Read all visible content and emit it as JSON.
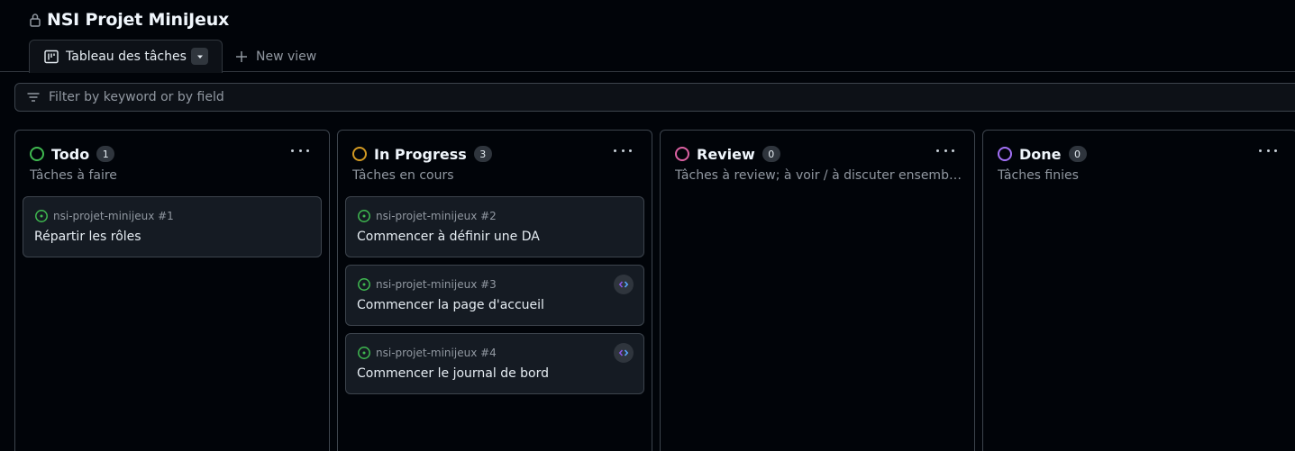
{
  "project": {
    "title": "NSI Projet MiniJeux"
  },
  "tabs": {
    "active_label": "Tableau des tâches",
    "new_view_label": "New view"
  },
  "filter": {
    "placeholder": "Filter by keyword or by field"
  },
  "colors": {
    "todo": "#3fb950",
    "in_progress": "#d29922",
    "review": "#db61a2",
    "done": "#a371f7",
    "issue_open": "#3fb950",
    "badge_accent": "#8957e5"
  },
  "columns": [
    {
      "name": "Todo",
      "count": "1",
      "description": "Tâches à faire",
      "cards": [
        {
          "repo": "nsi-projet-minijeux #1",
          "title": "Répartir les rôles"
        }
      ]
    },
    {
      "name": "In Progress",
      "count": "3",
      "description": "Tâches en cours",
      "cards": [
        {
          "repo": "nsi-projet-minijeux #2",
          "title": "Commencer à définir une DA"
        },
        {
          "repo": "nsi-projet-minijeux #3",
          "title": "Commencer la page d'accueil",
          "badge_icon": "code-icon"
        },
        {
          "repo": "nsi-projet-minijeux #4",
          "title": "Commencer le journal de bord",
          "badge_icon": "code-icon"
        }
      ]
    },
    {
      "name": "Review",
      "count": "0",
      "description": "Tâches à review; à voir / à discuter ensemble...",
      "cards": []
    },
    {
      "name": "Done",
      "count": "0",
      "description": "Tâches finies",
      "cards": []
    }
  ]
}
